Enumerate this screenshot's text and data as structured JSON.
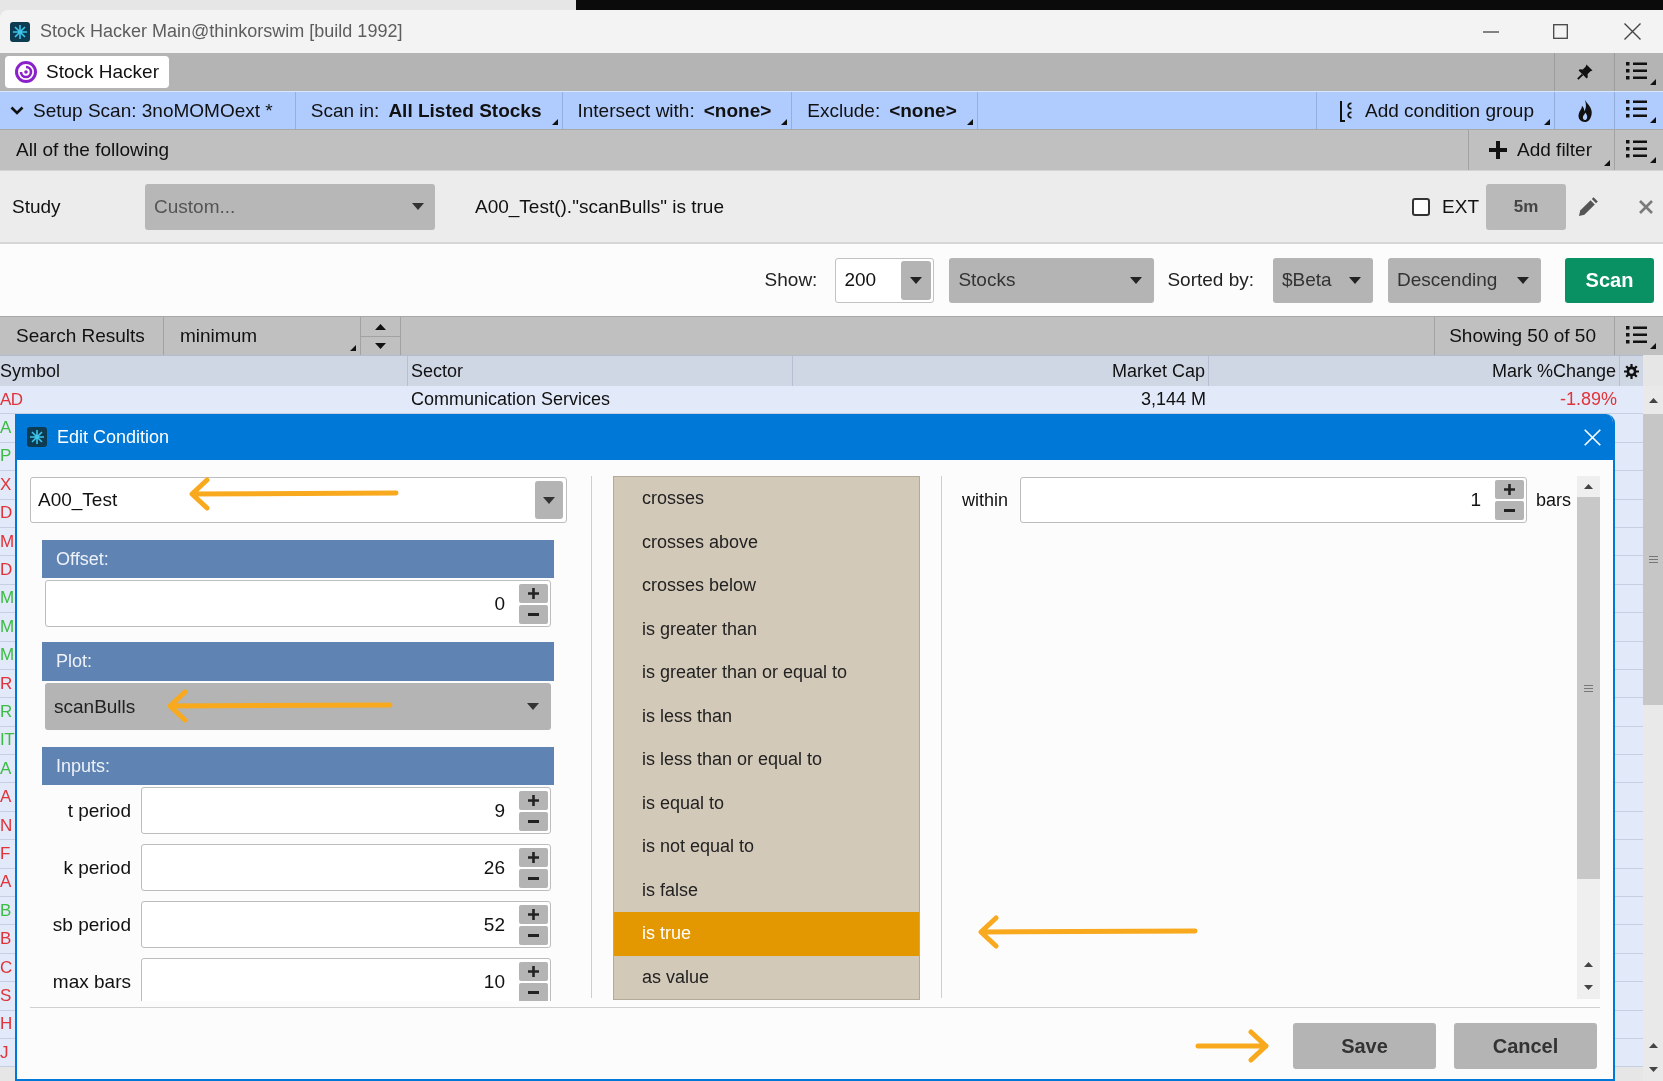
{
  "window": {
    "title": "Stock Hacker Main@thinkorswim [build 1992]"
  },
  "tabs": [
    {
      "label": "Stock Hacker",
      "selected": true
    }
  ],
  "scan_bar": {
    "setup": {
      "label": "Setup Scan: 3noMOMOext *",
      "expanded": true
    },
    "menus": [
      "Scan in: **All Listed Stocks**",
      "Intersect with: **<none>**",
      "Exclude: **<none>**"
    ],
    "add_group": "Add condition group"
  },
  "filter_bar": {
    "label": "All of the following",
    "add_filter": "Add filter"
  },
  "filters": [
    {
      "kind": "study",
      "label": "Study",
      "study": "Custom...",
      "condition": "A00_Test().\"scanBulls\" is true",
      "ext": {
        "label": "EXT",
        "checked": false
      },
      "aggregation": "5m"
    }
  ],
  "scan_options": {
    "show_label": "Show:",
    "limit": "200",
    "type": "Stocks",
    "sort_label": "Sorted by:",
    "sort_field": "$Beta",
    "sort_order": "Descending",
    "scan_button": "Scan"
  },
  "results_bar": {
    "title": "Search Results",
    "view": "minimum",
    "count": "Showing 50 of 50"
  },
  "table": {
    "columns": [
      "Symbol",
      "Sector",
      "Market Cap",
      "Mark %Change"
    ],
    "rows": [
      {
        "symbol": "AD",
        "sector": "Communication Services",
        "market_cap": "3,144 M",
        "mark_change": "-1.89%",
        "color": "#e0333a"
      },
      {
        "symbol": "A",
        "color": "#3cbc45"
      },
      {
        "symbol": "P",
        "color": "#3cbc45"
      },
      {
        "symbol": "X",
        "color": "#e0333a"
      },
      {
        "symbol": "D",
        "color": "#e0333a"
      },
      {
        "symbol": "M",
        "color": "#e0333a"
      },
      {
        "symbol": "D",
        "color": "#e0333a"
      },
      {
        "symbol": "M",
        "color": "#3cbc45"
      },
      {
        "symbol": "M",
        "color": "#3cbc45"
      },
      {
        "symbol": "M",
        "color": "#3cbc45"
      },
      {
        "symbol": "R",
        "color": "#e0333a"
      },
      {
        "symbol": "R",
        "color": "#3cbc45"
      },
      {
        "symbol": "IT",
        "color": "#3cbc45"
      },
      {
        "symbol": "A",
        "color": "#3cbc45"
      },
      {
        "symbol": "A",
        "color": "#e0333a"
      },
      {
        "symbol": "N",
        "color": "#e0333a"
      },
      {
        "symbol": "F",
        "color": "#e0333a"
      },
      {
        "symbol": "A",
        "color": "#e0333a"
      },
      {
        "symbol": "B",
        "color": "#3cbc45"
      },
      {
        "symbol": "B",
        "color": "#e0333a"
      },
      {
        "symbol": "C",
        "color": "#e0333a"
      },
      {
        "symbol": "S",
        "color": "#e0333a"
      },
      {
        "symbol": "H",
        "color": "#e0333a"
      },
      {
        "symbol": "J",
        "color": "#e0333a"
      }
    ]
  },
  "dialog": {
    "title": "Edit Condition",
    "study": {
      "value": "A00_Test",
      "arrow_left": true
    },
    "offset": {
      "label": "Offset:",
      "value": "0"
    },
    "plot": {
      "label": "Plot:",
      "value": "scanBulls",
      "arrow_left": true
    },
    "inputs": {
      "label": "Inputs:",
      "fields": [
        {
          "label": "t period",
          "value": "9"
        },
        {
          "label": "k period",
          "value": "26"
        },
        {
          "label": "sb period",
          "value": "52"
        },
        {
          "label": "max bars",
          "value": "10"
        }
      ]
    },
    "conditions": [
      {
        "label": "crosses",
        "selected": false,
        "arrow_left": false
      },
      {
        "label": "crosses above",
        "selected": false,
        "arrow_left": false
      },
      {
        "label": "crosses below",
        "selected": false,
        "arrow_left": false
      },
      {
        "label": "is greater than",
        "selected": false,
        "arrow_left": false
      },
      {
        "label": "is greater than or equal to",
        "selected": false,
        "arrow_left": false
      },
      {
        "label": "is less than",
        "selected": false,
        "arrow_left": false
      },
      {
        "label": "is less than or equal to",
        "selected": false,
        "arrow_left": false
      },
      {
        "label": "is equal to",
        "selected": false,
        "arrow_left": false
      },
      {
        "label": "is not equal to",
        "selected": false,
        "arrow_left": false
      },
      {
        "label": "is false",
        "selected": false,
        "arrow_left": false
      },
      {
        "label": "is true",
        "selected": true,
        "arrow_left": true
      },
      {
        "label": "as value",
        "selected": false,
        "arrow_left": false
      }
    ],
    "within": {
      "label": "within",
      "value": "1",
      "unit": "bars"
    },
    "buttons": [
      {
        "label": "Save",
        "arrow_right": true
      },
      {
        "label": "Cancel",
        "arrow_right": false
      }
    ]
  }
}
